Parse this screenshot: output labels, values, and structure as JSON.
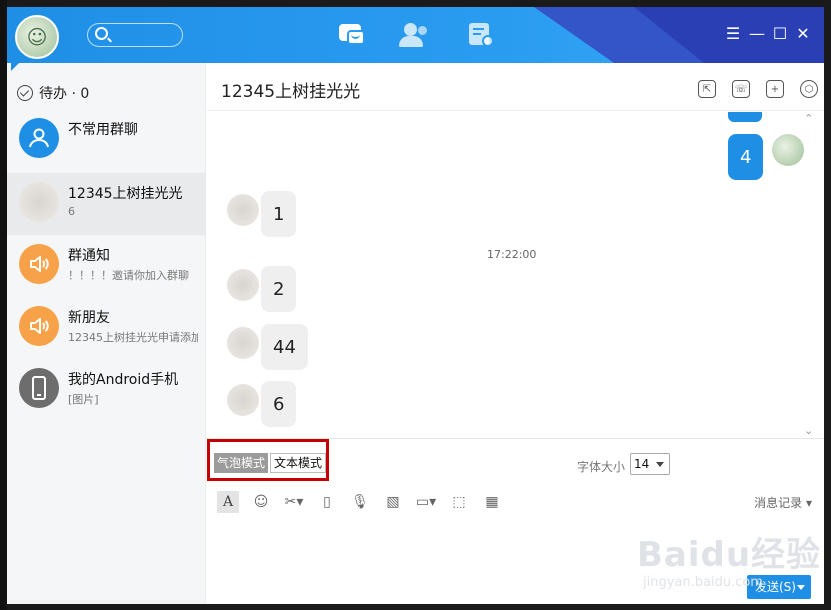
{
  "sidebar": {
    "todo_label": "待办 · 0",
    "conversations": [
      {
        "name": "不常用群聊",
        "sub": "",
        "avatar_color": "#1f8fe6",
        "icon": "group-icon"
      },
      {
        "name": "12345上树挂光光",
        "sub": "6",
        "avatar_color": "#e0dcd8",
        "icon": "user-avatar"
      },
      {
        "name": "群通知",
        "sub": "！！！！邀请你加入群聊",
        "avatar_color": "#f7a248",
        "icon": "speaker-icon"
      },
      {
        "name": "新朋友",
        "sub": "12345上树挂光光申请添加",
        "avatar_color": "#f7a248",
        "icon": "speaker-icon"
      },
      {
        "name": "我的Android手机",
        "sub": "[图片]",
        "avatar_color": "#6d6d6d",
        "icon": "phone-icon"
      }
    ]
  },
  "chat": {
    "title": "12345上树挂光光",
    "messages": [
      {
        "text": "4",
        "mine": true
      },
      {
        "text": "1",
        "mine": false
      },
      {
        "text": "2",
        "mine": false
      },
      {
        "text": "44",
        "mine": false
      },
      {
        "text": "6",
        "mine": false
      }
    ],
    "timestamp": "17:22:00"
  },
  "input": {
    "mode_bubble": "气泡模式",
    "mode_text": "文本模式",
    "font_size_label": "字体大小",
    "font_size_value": "14",
    "history_label": "消息记录",
    "send_label": "发送(S)"
  },
  "watermark": {
    "main": "Baidu经验",
    "sub": "jingyan.baidu.com"
  },
  "colors": {
    "accent": "#1f8fe6",
    "highlight_box": "#c40000"
  }
}
